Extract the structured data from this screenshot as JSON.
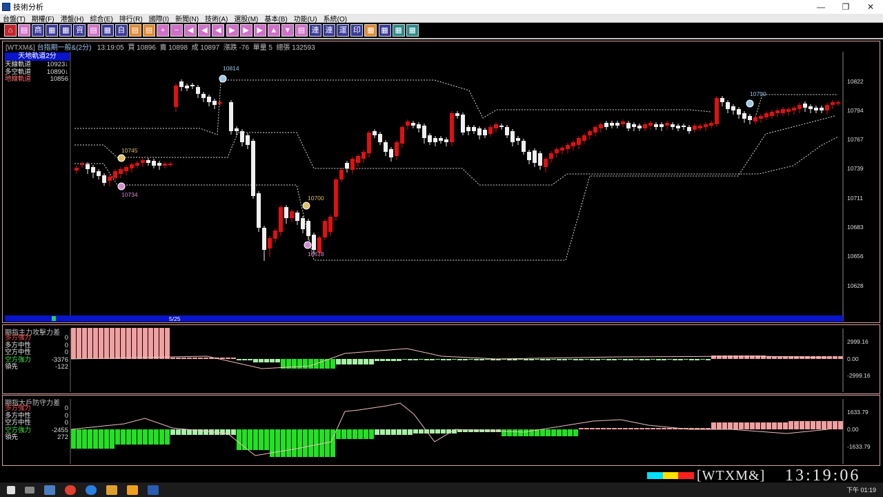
{
  "window": {
    "title": "技術分析",
    "minimize": "—",
    "restore": "❐",
    "close": "✕"
  },
  "menu": [
    "台盤(T)",
    "期權(F)",
    "港盤(H)",
    "綜合(E)",
    "排行(R)",
    "國際(I)",
    "新聞(N)",
    "技術(A)",
    "選股(M)",
    "基本(B)",
    "功能(U)",
    "系統(O)"
  ],
  "toolbar_glyphs": [
    "⌂",
    "▤",
    "商",
    "▦",
    "▦",
    "資",
    "▤",
    "▦",
    "自",
    "▤",
    "▤",
    "+",
    "−",
    "◀",
    "◀",
    "◀",
    "▶",
    "▶",
    "▶",
    "▲",
    "▼",
    "▤",
    "連",
    "連",
    "運",
    "印",
    "▦",
    "▦",
    "▦",
    "▦"
  ],
  "quote": {
    "symbol": "[WTXM&]",
    "name": "台指期一般&(2分)",
    "time": "13:19:05",
    "buy": "買 10896",
    "sell": "賣 10898",
    "deal": "成 10897",
    "change": "漲跌 -76",
    "vol": "單量 5",
    "total": "總張 132593"
  },
  "main_indicator": {
    "title": "天地軌道2分",
    "rows": [
      {
        "label": "天線軌道",
        "value": "10923↓",
        "color": "#e8e8e8"
      },
      {
        "label": "多空軌道",
        "value": "10890↓",
        "color": "#e8e8e8"
      },
      {
        "label": "地線軌道",
        "value": "10856",
        "color": "#ff7070"
      }
    ]
  },
  "price_axis": [
    "10822",
    "10794",
    "10767",
    "10739",
    "10711",
    "10683",
    "10656",
    "10628"
  ],
  "date_label": "5/25",
  "annotations": [
    {
      "text": "10814",
      "color": "#9bc8e8"
    },
    {
      "text": "10745",
      "color": "#e0c060"
    },
    {
      "text": "10734",
      "color": "#d090d0"
    },
    {
      "text": "10700",
      "color": "#e0c060"
    },
    {
      "text": "10678",
      "color": "#d090d0"
    },
    {
      "text": "10790",
      "color": "#9bc8e8"
    }
  ],
  "panel1": {
    "title": "期指主力攻擊力差",
    "rows": [
      {
        "label": "多方強力",
        "value": "0",
        "color": "#ff5050"
      },
      {
        "label": "多方中性",
        "value": "0",
        "color": "#e8e8e8"
      },
      {
        "label": "空方中性",
        "value": "0",
        "color": "#e8e8e8"
      },
      {
        "label": "空方強力",
        "value": "-3376",
        "color": "#40e040"
      },
      {
        "label": "領先",
        "value": "-122",
        "color": "#e8e8e8"
      }
    ],
    "axis": [
      "2999.16",
      "0.00",
      "-2999.16"
    ]
  },
  "panel2": {
    "title": "期指大戶防守力差",
    "rows": [
      {
        "label": "多方強力",
        "value": "0",
        "color": "#ff5050"
      },
      {
        "label": "多方中性",
        "value": "0",
        "color": "#e8e8e8"
      },
      {
        "label": "空方中性",
        "value": "0",
        "color": "#e8e8e8"
      },
      {
        "label": "空方強力",
        "value": "-2455",
        "color": "#40e040"
      },
      {
        "label": "領先",
        "value": "272",
        "color": "#e8e8e8"
      }
    ],
    "axis": [
      "1633.79",
      "0.00",
      "-1633.79"
    ]
  },
  "status": {
    "ticker": "WTXM&",
    "clock": "13:19:06"
  },
  "taskbar": {
    "clock": "下午 01:19"
  }
}
